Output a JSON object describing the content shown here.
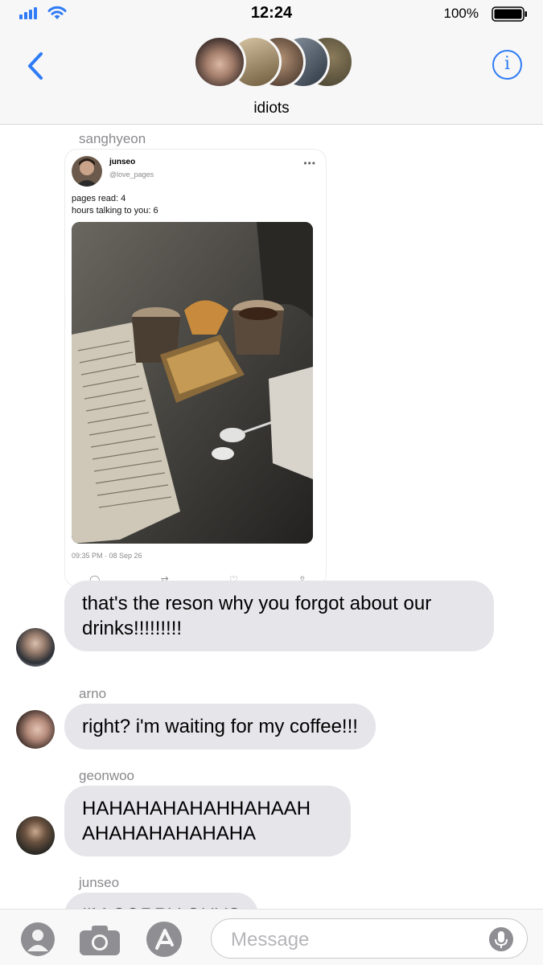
{
  "status": {
    "time": "12:24",
    "battery": "100%"
  },
  "header": {
    "title": "idiots",
    "info_label": "i"
  },
  "conversation": {
    "items": [
      {
        "sender": "sanghyeon"
      },
      {
        "text": "that's the reson why you forgot about our drinks!!!!!!!!!"
      },
      {
        "sender": "arno",
        "text": "right? i'm waiting for my coffee!!!"
      },
      {
        "sender": "geonwoo",
        "text": "HAHAHAHAHAHHAHAAH AHAHAHAHAHAHA"
      },
      {
        "sender": "junseo",
        "text": "I'M SORRY GUYS"
      }
    ]
  },
  "tweet": {
    "name": "junseo",
    "handle": "@love_pages",
    "text_line1": "pages read: 4",
    "text_line2": "hours talking to you: 6",
    "date": "09:35 PM · 08 Sep 26"
  },
  "compose": {
    "placeholder": "Message"
  },
  "colors": {
    "accent": "#2f7cf6",
    "bubble": "#e5e5ea",
    "background": "#ffffff",
    "bar": "#f7f7f7"
  }
}
